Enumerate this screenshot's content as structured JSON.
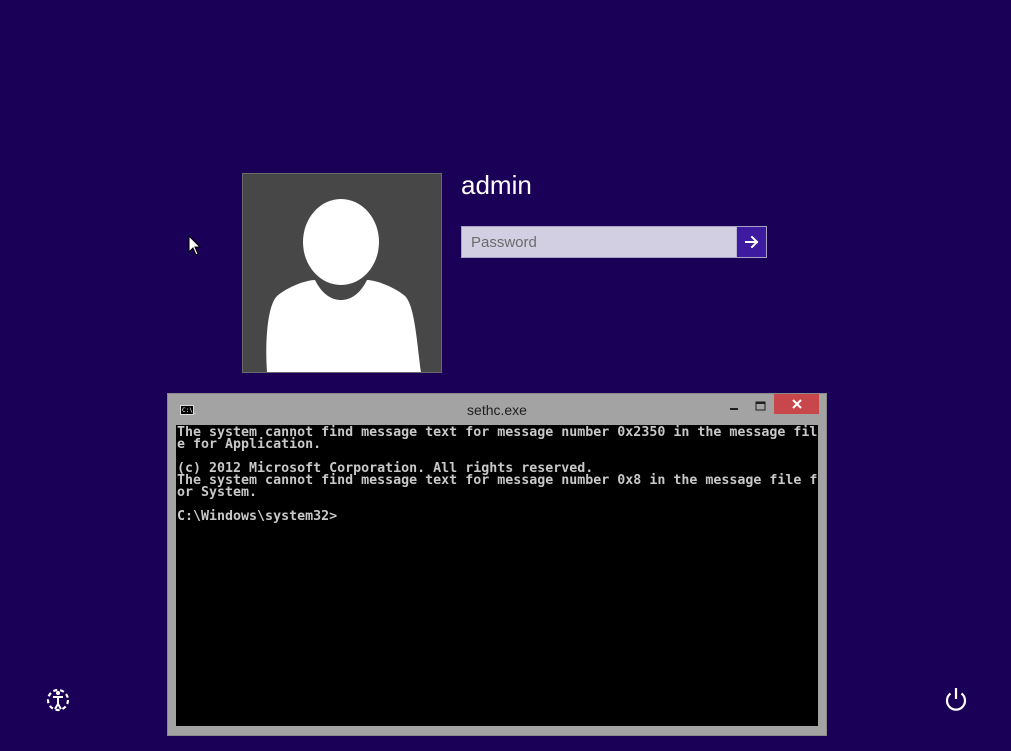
{
  "login": {
    "username": "admin",
    "password_placeholder": "Password",
    "password_value": ""
  },
  "icons": {
    "avatar": "default-user-silhouette",
    "submit": "arrow-right-icon",
    "ease_of_access": "ease-of-access-icon",
    "power": "power-icon",
    "console": "console-icon",
    "cursor": "mouse-pointer"
  },
  "console": {
    "title": "sethc.exe",
    "icon_label": "C:\\_",
    "lines": [
      "The system cannot find message text for message number 0x2350 in the message fil",
      "e for Application.",
      "",
      "(c) 2012 Microsoft Corporation. All rights reserved.",
      "The system cannot find message text for message number 0x8 in the message file f",
      "or System.",
      "",
      "C:\\Windows\\system32>"
    ]
  },
  "colors": {
    "background": "#1b0057",
    "accent_button": "#3d1a9f",
    "close_button": "#c7474a",
    "avatar_tile": "#474747",
    "console_frame": "#a3a3a3"
  }
}
